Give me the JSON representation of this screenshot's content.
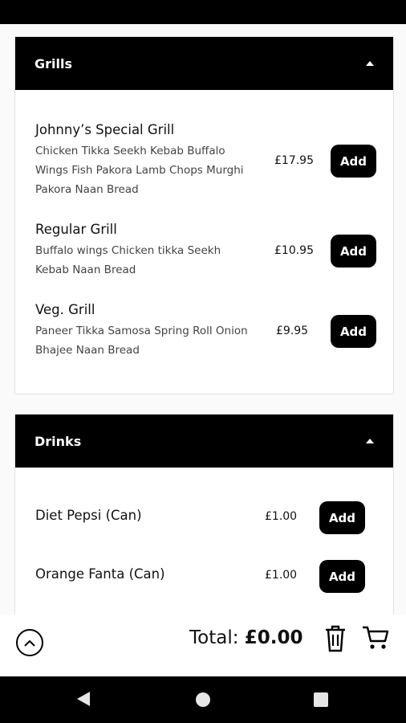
{
  "sections": [
    {
      "title": "Grills",
      "items": [
        {
          "name": "Johnny’s Special Grill",
          "description": "Chicken Tikka Seekh Kebab Buffalo Wings Fish Pakora Lamb Chops Murghi Pakora Naan Bread",
          "price": "£17.95",
          "button": "Add"
        },
        {
          "name": "Regular Grill",
          "description": "Buffalo wings Chicken tikka Seekh Kebab Naan Bread",
          "price": "£10.95",
          "button": "Add"
        },
        {
          "name": "Veg. Grill",
          "description": "Paneer Tikka Samosa Spring Roll Onion Bhajee Naan Bread",
          "price": "£9.95",
          "button": "Add"
        }
      ]
    },
    {
      "title": "Drinks",
      "items": [
        {
          "name": "Diet Pepsi (Can)",
          "price": "£1.00",
          "button": "Add"
        },
        {
          "name": "Orange Fanta (Can)",
          "price": "£1.00",
          "button": "Add"
        }
      ]
    }
  ],
  "footer": {
    "total_label": "Total:",
    "total_amount": "£0.00"
  },
  "icons": {
    "scroll_top": "chevron-up-icon",
    "trash": "trash-icon",
    "cart": "cart-icon",
    "nav_back": "back-triangle-icon",
    "nav_home": "home-circle-icon",
    "nav_recent": "recent-square-icon"
  },
  "colors": {
    "accent": "#000000",
    "background": "#fafafa",
    "card": "#ffffff"
  }
}
